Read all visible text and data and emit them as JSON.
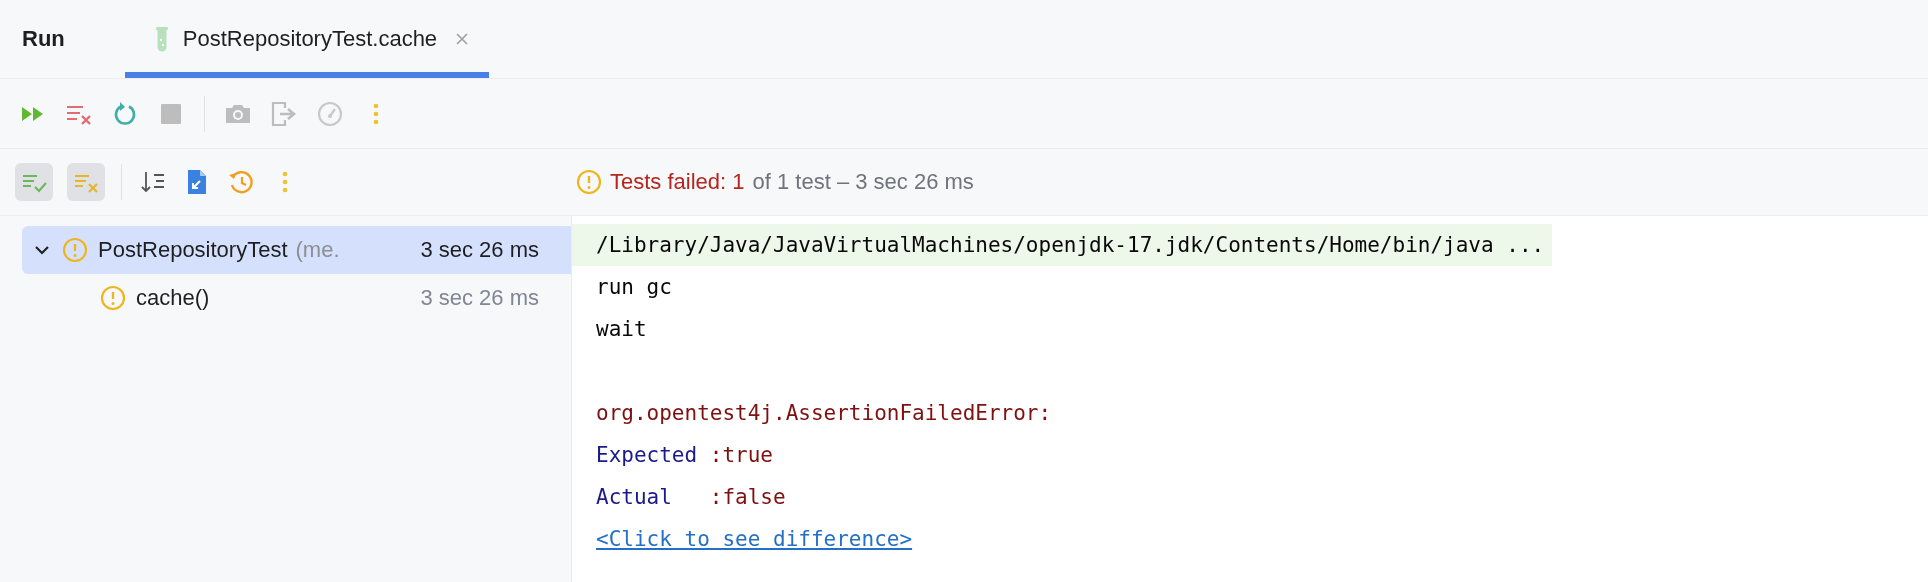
{
  "header": {
    "title": "Run",
    "tabs": [
      {
        "label": "PostRepositoryTest.cache",
        "selected": true
      }
    ]
  },
  "filters": [
    {
      "kind": "passed",
      "on": true
    },
    {
      "kind": "ignored",
      "on": true
    }
  ],
  "status": {
    "failed": "Tests failed: 1",
    "summary": "of 1 test – 3 sec 26 ms"
  },
  "tree": [
    {
      "name": "PostRepositoryTest",
      "detail": "(me.",
      "time": "3 sec 26 ms",
      "expanded": true,
      "selected": true,
      "children": [
        {
          "name": "cache()",
          "time": "3 sec 26 ms",
          "selected": false
        }
      ]
    }
  ],
  "console": [
    {
      "kind": "command",
      "text": "/Library/Java/JavaVirtualMachines/openjdk-17.jdk/Contents/Home/bin/java ..."
    },
    {
      "kind": "output",
      "text": "run gc"
    },
    {
      "kind": "output",
      "text": "wait"
    },
    {
      "kind": "error",
      "text": "org.opentest4j.AssertionFailedError:"
    },
    {
      "kind": "comparison",
      "label": "Expected",
      "value": ":true"
    },
    {
      "kind": "comparison",
      "label": "Actual",
      "value": ":false"
    },
    {
      "kind": "link",
      "text": "<Click to see difference>"
    }
  ]
}
